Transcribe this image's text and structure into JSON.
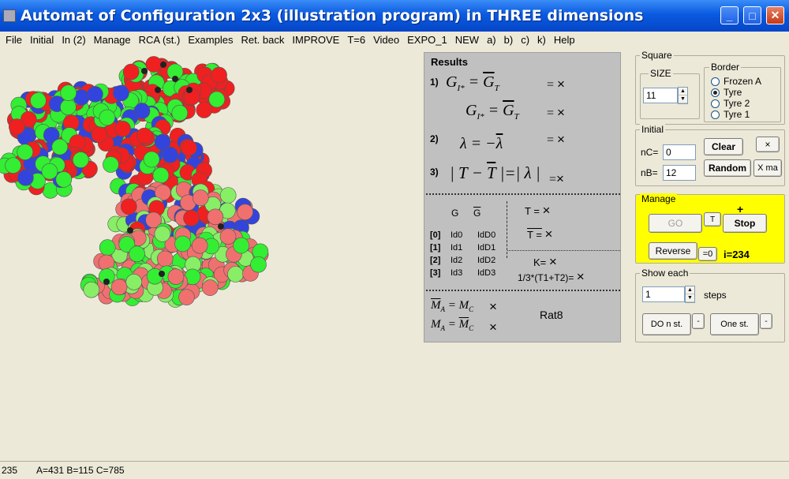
{
  "window": {
    "title": "Automat of Configuration 2x3 (illustration program) in THREE dimensions",
    "minimize_label": "_",
    "maximize_label": "□",
    "close_label": "✕"
  },
  "menu": [
    "File",
    "Initial",
    "In (2)",
    "Manage",
    "RCA (st.)",
    "Examples",
    "Ret. back",
    "IMPROVE",
    "T=6",
    "Video",
    "EXPO_1",
    "NEW",
    "a)",
    "b)",
    "c)",
    "k)",
    "Help"
  ],
  "results": {
    "title": "Results",
    "n1": "1)",
    "n2": "2)",
    "n3": "3)",
    "x": "×",
    "eq": "=",
    "row_g": "G",
    "row_gbar": "G",
    "t_eq": "T =",
    "tbar_eq": "T =",
    "k_eq": "K=",
    "third": "1/3*(T1+T2)=",
    "idx": [
      "[0]",
      "[1]",
      "[2]",
      "[3]"
    ],
    "id": [
      "Id0",
      "Id1",
      "Id2",
      "Id3"
    ],
    "idd": [
      "IdD0",
      "IdD1",
      "IdD2",
      "IdD3"
    ],
    "rat": "Rat8"
  },
  "square": {
    "title": "Square",
    "size_title": "SIZE",
    "size_value": "11",
    "border_title": "Border",
    "border_options": [
      "Frozen A",
      "Tyre",
      "Tyre 2",
      "Tyre 1"
    ],
    "border_selected": "Tyre"
  },
  "initial": {
    "title": "Initial",
    "nc_label": "nC=",
    "nc_value": "0",
    "nb_label": "nB=",
    "nb_value": "12",
    "clear_label": "Clear",
    "random_label": "Random",
    "x_label": "×",
    "xma_label": "X ma"
  },
  "manage": {
    "title": "Manage",
    "go_label": "GO",
    "t_label": "T",
    "plus_label": "+",
    "stop_label": "Stop",
    "reverse_label": "Reverse",
    "eq0_label": "=0",
    "counter": "i=234"
  },
  "show_each": {
    "title": "Show each",
    "value": "1",
    "steps_label": "steps",
    "do_label": "DO n st.",
    "do_small": "-",
    "one_label": "One st.",
    "one_small": "-"
  },
  "status": {
    "left": "235",
    "counts": "A=431 B=115 C=785"
  },
  "colors": {
    "red": "#f02020",
    "red_light": "#f07070",
    "green": "#33ee33",
    "green_light": "#88ee66",
    "blue": "#3344dd",
    "yellow_panel": "#ffff00",
    "title_blue": "#0a5ae0"
  }
}
